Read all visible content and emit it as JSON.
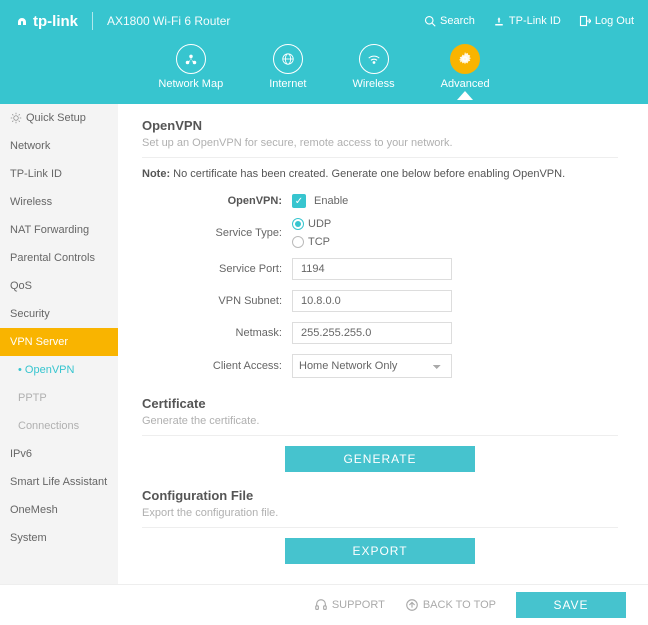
{
  "brand": {
    "text": "tp-link",
    "device": "AX1800 Wi-Fi 6 Router"
  },
  "top_actions": {
    "search": "Search",
    "tplink_id": "TP-Link ID",
    "logout": "Log Out"
  },
  "tabs": {
    "map": "Network Map",
    "internet": "Internet",
    "wireless": "Wireless",
    "advanced": "Advanced"
  },
  "sidebar": {
    "quick": "Quick Setup",
    "items": [
      "Network",
      "TP-Link ID",
      "Wireless",
      "NAT Forwarding",
      "Parental Controls",
      "QoS",
      "Security",
      "VPN Server"
    ],
    "subs": [
      "OpenVPN",
      "PPTP",
      "Connections"
    ],
    "tail": [
      "IPv6",
      "Smart Life Assistant",
      "OneMesh",
      "System"
    ]
  },
  "openvpn": {
    "title": "OpenVPN",
    "desc": "Set up an OpenVPN for secure, remote access to your network.",
    "note_label": "Note:",
    "note_text": "No certificate has been created. Generate one below before enabling OpenVPN.",
    "labels": {
      "enable": "OpenVPN:",
      "enable_text": "Enable",
      "service_type": "Service Type:",
      "udp": "UDP",
      "tcp": "TCP",
      "port": "Service Port:",
      "subnet": "VPN Subnet:",
      "netmask": "Netmask:",
      "access": "Client Access:"
    },
    "values": {
      "port": "1194",
      "subnet": "10.8.0.0",
      "netmask": "255.255.255.0",
      "access": "Home Network Only"
    }
  },
  "cert": {
    "title": "Certificate",
    "desc": "Generate the certificate.",
    "btn": "GENERATE"
  },
  "config": {
    "title": "Configuration File",
    "desc": "Export the configuration file.",
    "btn": "EXPORT"
  },
  "footer": {
    "support": "SUPPORT",
    "back": "BACK TO TOP",
    "save": "SAVE"
  }
}
